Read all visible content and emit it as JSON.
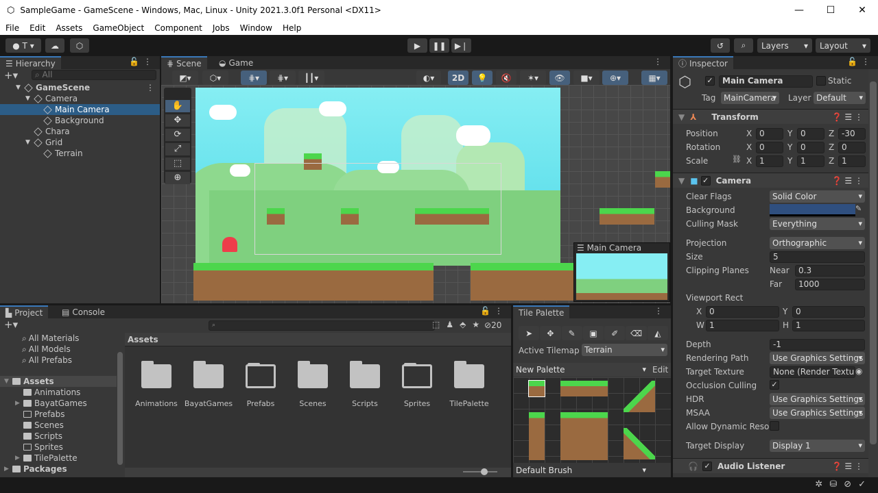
{
  "window": {
    "title": "SampleGame - GameScene - Windows, Mac, Linux - Unity 2021.3.0f1 Personal <DX11>",
    "minimize": "—",
    "maximize": "☐",
    "close": "✕"
  },
  "menu": [
    "File",
    "Edit",
    "Assets",
    "GameObject",
    "Component",
    "Jobs",
    "Window",
    "Help"
  ],
  "toolbar": {
    "account": "T",
    "layers": "Layers",
    "layout": "Layout"
  },
  "hierarchy": {
    "tab": "Hierarchy",
    "search_placeholder": "All",
    "items": [
      {
        "label": "GameScene",
        "level": 0,
        "selected": false
      },
      {
        "label": "Camera",
        "level": 1,
        "selected": false
      },
      {
        "label": "Main Camera",
        "level": 2,
        "selected": true
      },
      {
        "label": "Background",
        "level": 2,
        "selected": false
      },
      {
        "label": "Chara",
        "level": 1,
        "selected": false
      },
      {
        "label": "Grid",
        "level": 1,
        "selected": false
      },
      {
        "label": "Terrain",
        "level": 2,
        "selected": false
      }
    ]
  },
  "scene": {
    "tabs": [
      "Scene",
      "Game"
    ],
    "mode_2d": "2D",
    "camera_preview_title": "Main Camera",
    "sky_color": "#7ce8f0",
    "ground_color": "#9a6a40",
    "grass_color": "#4cd64c"
  },
  "inspector": {
    "tab": "Inspector",
    "object_name": "Main Camera",
    "static_label": "Static",
    "tag_label": "Tag",
    "tag": "MainCamera",
    "layer_label": "Layer",
    "layer": "Default",
    "transform": {
      "title": "Transform",
      "rows": [
        {
          "label": "Position",
          "x": "0",
          "y": "0",
          "z": "-30"
        },
        {
          "label": "Rotation",
          "x": "0",
          "y": "0",
          "z": "0"
        },
        {
          "label": "Scale",
          "x": "1",
          "y": "1",
          "z": "1"
        }
      ]
    },
    "camera": {
      "title": "Camera",
      "clear_flags_label": "Clear Flags",
      "clear_flags": "Solid Color",
      "background_label": "Background",
      "background_color": "#2f4f7f",
      "culling_mask_label": "Culling Mask",
      "culling_mask": "Everything",
      "projection_label": "Projection",
      "projection": "Orthographic",
      "size_label": "Size",
      "size": "5",
      "clipping_label": "Clipping Planes",
      "near_label": "Near",
      "near": "0.3",
      "far_label": "Far",
      "far": "1000",
      "viewport_label": "Viewport Rect",
      "vx": "0",
      "vy": "0",
      "vw": "1",
      "vh": "1",
      "depth_label": "Depth",
      "depth": "-1",
      "rendering_path_label": "Rendering Path",
      "rendering_path": "Use Graphics Settings",
      "target_texture_label": "Target Texture",
      "target_texture": "None (Render Texture)",
      "occlusion_label": "Occlusion Culling",
      "hdr_label": "HDR",
      "hdr": "Use Graphics Settings",
      "msaa_label": "MSAA",
      "msaa": "Use Graphics Settings",
      "dynres_label": "Allow Dynamic Resol",
      "target_display_label": "Target Display",
      "target_display": "Display 1"
    },
    "audio_listener": {
      "title": "Audio Listener"
    }
  },
  "project": {
    "tabs": [
      "Project",
      "Console"
    ],
    "hidden_count": "20",
    "breadcrumb": "Assets",
    "favorites": [
      "All Materials",
      "All Models",
      "All Prefabs"
    ],
    "tree": [
      {
        "label": "Assets",
        "level": 0
      },
      {
        "label": "Animations",
        "level": 1
      },
      {
        "label": "BayatGames",
        "level": 1
      },
      {
        "label": "Prefabs",
        "level": 1
      },
      {
        "label": "Scenes",
        "level": 1
      },
      {
        "label": "Scripts",
        "level": 1
      },
      {
        "label": "Sprites",
        "level": 1
      },
      {
        "label": "TilePalette",
        "level": 1
      },
      {
        "label": "Packages",
        "level": 0
      }
    ],
    "folders": [
      {
        "name": "Animations",
        "empty": false
      },
      {
        "name": "BayatGames",
        "empty": false
      },
      {
        "name": "Prefabs",
        "empty": true
      },
      {
        "name": "Scenes",
        "empty": false
      },
      {
        "name": "Scripts",
        "empty": false
      },
      {
        "name": "Sprites",
        "empty": true
      },
      {
        "name": "TilePalette",
        "empty": false
      }
    ]
  },
  "tile_palette": {
    "tab": "Tile Palette",
    "active_tilemap_label": "Active Tilemap",
    "active_tilemap": "Terrain",
    "palette": "New Palette",
    "edit": "Edit",
    "brush": "Default Brush"
  }
}
